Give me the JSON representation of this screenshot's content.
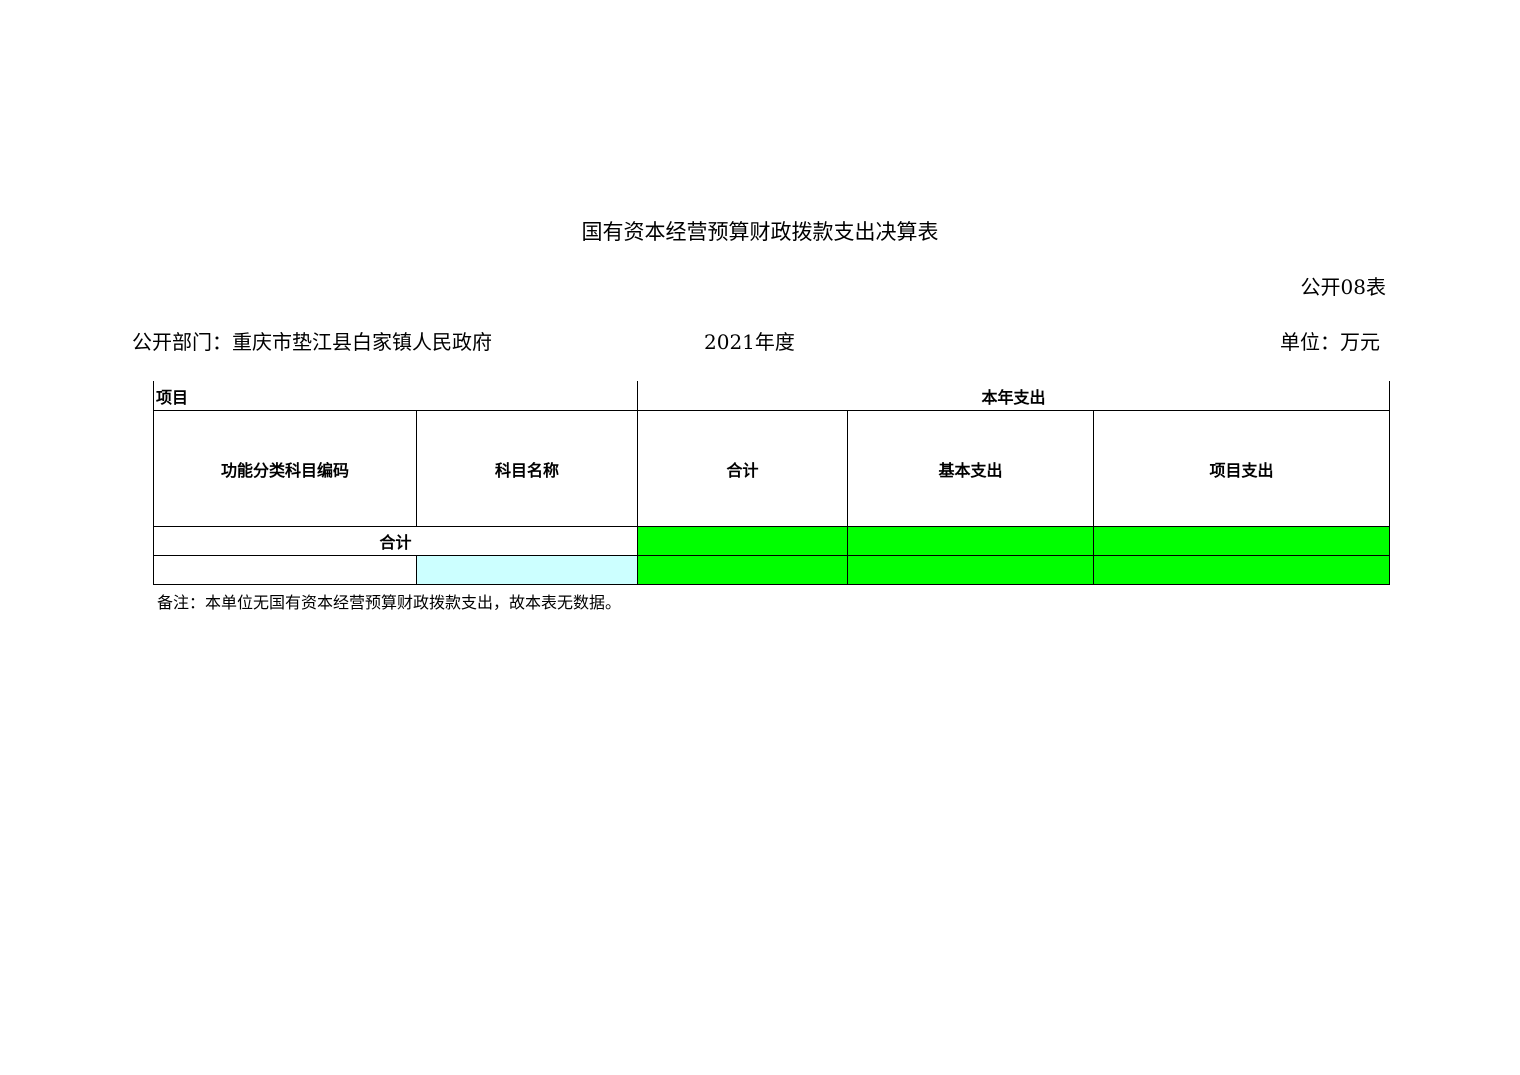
{
  "document": {
    "title": "国有资本经营预算财政拨款支出决算表",
    "table_no": "公开08表",
    "department": "公开部门：重庆市垫江县白家镇人民政府",
    "year": "2021年度",
    "unit": "单位：万元"
  },
  "table": {
    "group_headers": {
      "item": "项目",
      "current_year_expense": "本年支出"
    },
    "columns": [
      "功能分类科目编码",
      "科目名称",
      "合计",
      "基本支出",
      "项目支出"
    ],
    "total_row": {
      "label": "合计",
      "total": "",
      "basic": "",
      "project": ""
    },
    "data_row": {
      "code": "",
      "name": "",
      "total": "",
      "basic": "",
      "project": ""
    },
    "colors": {
      "amount_cells": "#00ff00",
      "name_cell": "#ccffff"
    }
  },
  "note": "备注：本单位无国有资本经营预算财政拨款支出，故本表无数据。"
}
